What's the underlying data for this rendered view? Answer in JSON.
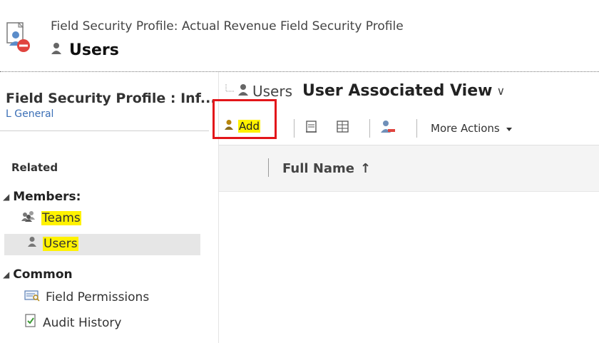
{
  "header": {
    "subtitle": "Field Security Profile: Actual Revenue Field Security Profile",
    "title": "Users"
  },
  "nav": {
    "title": "Field Security Profile : Inf...",
    "general_link": "L General",
    "related_label": "Related",
    "groups": [
      {
        "label": "Members:",
        "items": [
          {
            "label": "Teams",
            "icon": "teams-icon"
          },
          {
            "label": "Users",
            "icon": "user-icon",
            "selected": true
          }
        ]
      },
      {
        "label": "Common",
        "items": [
          {
            "label": "Field Permissions",
            "icon": "field-permissions-icon"
          },
          {
            "label": "Audit History",
            "icon": "audit-history-icon"
          }
        ]
      }
    ]
  },
  "view": {
    "entity_label": "Users",
    "view_name": "User Associated View",
    "chevron": "∨"
  },
  "toolbar": {
    "add_label": "Add",
    "more_actions_label": "More Actions",
    "icons": [
      "report-icon",
      "export-icon",
      "remove-user-icon"
    ]
  },
  "grid": {
    "columns": [
      {
        "label": "Full Name",
        "sort": "ascending"
      }
    ],
    "sort_glyph": "↑",
    "rows": []
  },
  "colors": {
    "highlight": "#fff200",
    "add_box_border": "#e3161a",
    "link": "#3b6fb6"
  }
}
